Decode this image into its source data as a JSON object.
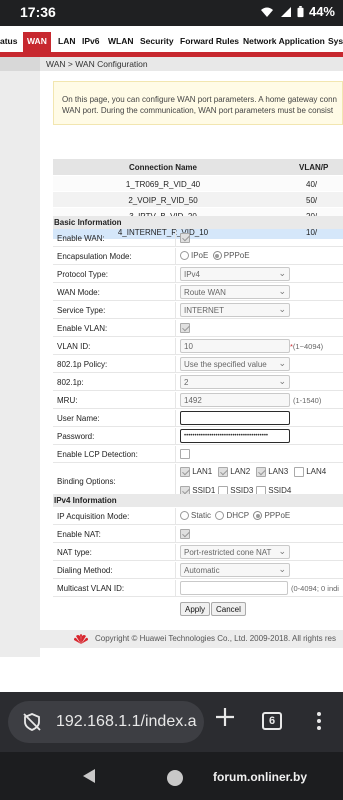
{
  "status_bar": {
    "time": "17:36",
    "battery": "44%"
  },
  "menu": {
    "items": [
      "atus",
      "WAN",
      "LAN",
      "IPv6",
      "WLAN",
      "Security",
      "Forward Rules",
      "Network Application",
      "Sys"
    ],
    "active": "WAN"
  },
  "breadcrumb": "WAN > WAN Configuration",
  "info": {
    "line1": "On this page, you can configure WAN port parameters. A home gateway conn",
    "line2": "WAN port. During the communication, WAN port parameters must be consist"
  },
  "connections": {
    "headers": {
      "name": "Connection Name",
      "vlan": "VLAN/P"
    },
    "rows": [
      {
        "name": "1_TR069_R_VID_40",
        "vlan": "40/"
      },
      {
        "name": "2_VOIP_R_VID_50",
        "vlan": "50/"
      },
      {
        "name": "3_IPTV_B_VID_20",
        "vlan": "20/"
      },
      {
        "name": "4_INTERNET_R_VID_10",
        "vlan": "10/"
      }
    ]
  },
  "basic": {
    "title": "Basic Information",
    "enable_wan": "Enable WAN:",
    "encap_label": "Encapsulation Mode:",
    "encap_ipoe": "IPoE",
    "encap_pppoe": "PPPoE",
    "protocol_label": "Protocol Type:",
    "protocol_value": "IPv4",
    "wan_mode_label": "WAN Mode:",
    "wan_mode_value": "Route WAN",
    "service_label": "Service Type:",
    "service_value": "INTERNET",
    "enable_vlan": "Enable VLAN:",
    "vlan_id_label": "VLAN ID:",
    "vlan_id_value": "10",
    "vlan_id_hint": "(1~4094)",
    "policy_label": "802.1p Policy:",
    "policy_value": "Use the specified value",
    "p8021_label": "802.1p:",
    "p8021_value": "2",
    "mru_label": "MRU:",
    "mru_value": "1492",
    "mru_hint": "(1-1540)",
    "user_label": "User Name:",
    "user_value": "",
    "password_label": "Password:",
    "password_value": "••••••••••••••••••••••••••••••••••••••••",
    "lcp_label": "Enable LCP Detection:",
    "binding_label": "Binding Options:",
    "binding": [
      "LAN1",
      "LAN2",
      "LAN3",
      "LAN4",
      "SSID1",
      "SSID3",
      "SSID4"
    ]
  },
  "ipv4": {
    "title": "IPv4 Information",
    "acq_label": "IP Acquisition Mode:",
    "acq_static": "Static",
    "acq_dhcp": "DHCP",
    "acq_pppoe": "PPPoE",
    "nat_enable_label": "Enable NAT:",
    "nat_type_label": "NAT type:",
    "nat_type_value": "Port-restricted cone NAT",
    "dial_label": "Dialing Method:",
    "dial_value": "Automatic",
    "mvlan_label": "Multicast VLAN ID:",
    "mvlan_value": "",
    "mvlan_hint": "(0-4094; 0 indi"
  },
  "buttons": {
    "apply": "Apply",
    "cancel": "Cancel"
  },
  "footer": "Copyright © Huawei Technologies Co., Ltd. 2009-2018. All rights res",
  "browser": {
    "url": "192.168.1.1/index.a",
    "tab_count": "6"
  },
  "watermark": "forum.onliner.by",
  "colors": {
    "accent": "#c7282f",
    "selected_row": "#d5e7fa"
  }
}
